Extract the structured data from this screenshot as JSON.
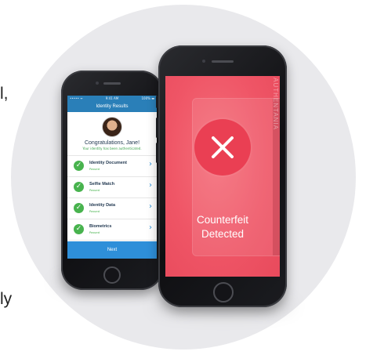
{
  "edge_text": {
    "top": "l,",
    "bottom": "ly"
  },
  "back_phone": {
    "status": {
      "carrier": "••••• ᯤ",
      "time": "9:41 AM",
      "battery": "100% ▬"
    },
    "nav_title": "Identity Results",
    "congrats_title": "Congratulations, Jane!",
    "congrats_sub": "Your identity has been authenticated.",
    "rows": [
      {
        "title": "Identity Document",
        "status": "Passed"
      },
      {
        "title": "Selfie Match",
        "status": "Passed"
      },
      {
        "title": "Identity Data",
        "status": "Passed"
      },
      {
        "title": "Biometrics",
        "status": "Passed"
      }
    ],
    "next_label": "Next"
  },
  "front_phone": {
    "card_text": "AUTHENTANIA",
    "result_line1": "Counterfeit",
    "result_line2": "Detected"
  },
  "colors": {
    "brand_blue": "#2a7fb8",
    "pass_green": "#48b34e",
    "alert_red": "#ef5566"
  }
}
